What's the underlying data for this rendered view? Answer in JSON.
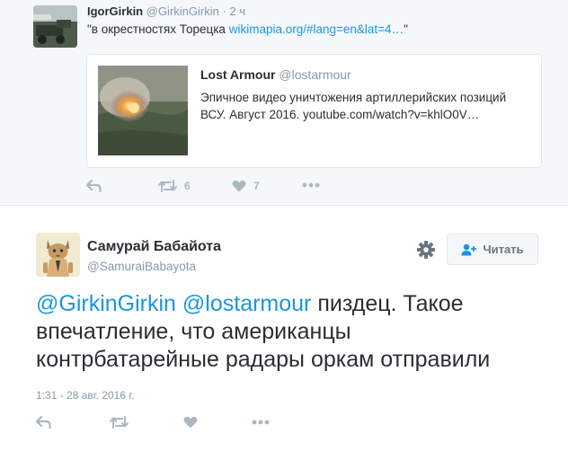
{
  "parent_tweet": {
    "name": "IgorGirkin",
    "handle": "@GirkinGirkin",
    "separator": "·",
    "time": "2 ч",
    "text_open": "\"в окрестностях Торецка ",
    "text_link": "wikimapia.org/#lang=en&lat=4…",
    "text_close": "\"",
    "quote": {
      "name": "Lost Armour",
      "handle": "@lostarmour",
      "text": "Эпичное видео уничтожения артиллерийских позиций ВСУ. Август 2016. youtube.com/watch?v=khlO0V…"
    },
    "actions": {
      "retweet_count": "6",
      "like_count": "7"
    }
  },
  "main_tweet": {
    "name": "Самурай Бабайота",
    "handle": "@SamuraiBabayota",
    "follow_label": "Читать",
    "mention1": "@GirkinGirkin",
    "mention2": "@lostarmour",
    "text": " пиздец. Такое впечатление, что американцы контрбатарейные радары оркам отправили",
    "timestamp": "1:31 - 28 авг. 2016 г."
  },
  "icons": {
    "reply": "reply-icon",
    "retweet": "retweet-icon",
    "like": "heart-icon",
    "more": "more-icon",
    "settings": "gear-icon",
    "follow": "add-user-icon"
  },
  "colors": {
    "link": "#1b95e0",
    "text": "#292f33",
    "muted": "#8899a6",
    "icon": "#aab8c2",
    "parent_bg": "#f5f8fa"
  }
}
